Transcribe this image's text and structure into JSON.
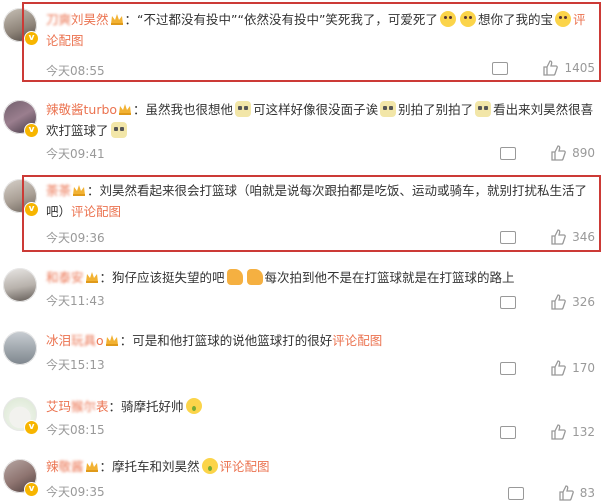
{
  "colors": {
    "accent": "#eb7350",
    "highlight_box": "#cc3a36",
    "muted": "#999999",
    "verified": "#f7b500"
  },
  "comments": [
    {
      "username": "",
      "username_visible": "刘昊然",
      "text_parts": [
        "：“不过都没有投中”“依然没有投中”笑死我了，可爱死了",
        "想你了我的宝"
      ],
      "link": "评论配图",
      "time": "今天08:55",
      "likes": "1405"
    },
    {
      "username": "辣敬酱turbo",
      "text_parts": [
        "：虽然我也很想他",
        "可这样好像很没面子诶",
        "别拍了别拍了",
        "看出来刘昊然很喜欢打篮球了"
      ],
      "time": "今天09:41",
      "likes": "890"
    },
    {
      "username": "",
      "text_parts": [
        "：刘昊然看起来很会打篮球（咱就是说每次跟拍都是吃饭、运动或骑车，就别打扰私生活了吧）"
      ],
      "link": "评论配图",
      "time": "今天09:36",
      "likes": "346"
    },
    {
      "username": "",
      "text_parts": [
        "：狗仔应该挺失望的吧",
        "每次拍到他不是在打篮球就是在打篮球的路上"
      ],
      "time": "今天11:43",
      "likes": "326"
    },
    {
      "username": "冰泪",
      "username_suffix": "o",
      "text_parts": [
        "：可是和他打篮球的说他篮球打的很好"
      ],
      "link": "评论配图",
      "time": "今天15:13",
      "likes": "170"
    },
    {
      "username": "艾玛",
      "username_suffix": "表",
      "text_parts": [
        "：骑摩托好帅"
      ],
      "time": "今天08:15",
      "likes": "132"
    },
    {
      "username": "辣",
      "text_parts": [
        "：摩托车和刘昊然"
      ],
      "link": "评论配图",
      "time": "今天09:35",
      "likes": "83"
    }
  ]
}
